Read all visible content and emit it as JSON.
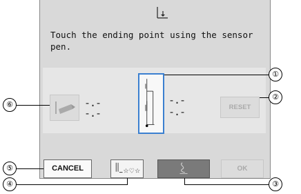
{
  "dialog": {
    "message": "Touch the ending point using the sensor\npen."
  },
  "values": {
    "left_top": "-.-",
    "left_bottom": "-.-",
    "right_top": "-.-",
    "right_bottom": "-.-"
  },
  "buttons": {
    "reset_label": "RESET",
    "cancel_label": "CANCEL",
    "ok_label": "OK"
  },
  "callouts": {
    "c1": "①",
    "c2": "②",
    "c3": "③",
    "c4": "④",
    "c5": "⑤",
    "c6": "⑥"
  },
  "icons": {
    "title": "needle-down-icon",
    "left_button": "angle-stitch-icon",
    "indicator": "needle-position-indicator",
    "pattern": "stitch-pattern-icon",
    "pen": "sensor-pen-icon"
  },
  "colors": {
    "callout_highlight": "#3a7fd0",
    "selected_button": "#7a7a7a"
  }
}
